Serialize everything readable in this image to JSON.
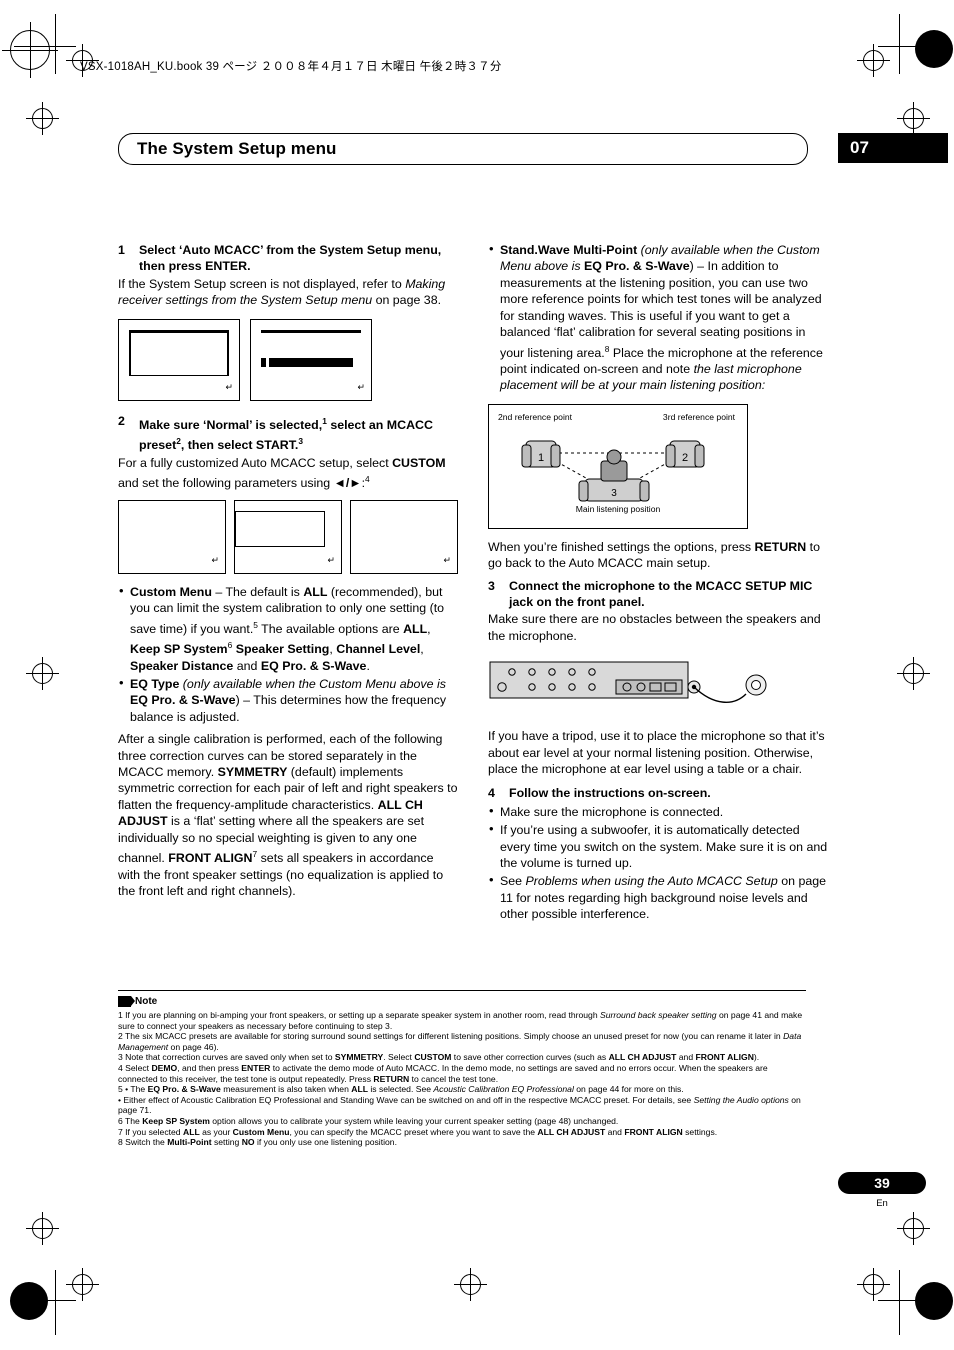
{
  "header": {
    "running_head": "VSX-1018AH_KU.book   39 ページ   ２００８年４月１７日   木曜日   午後２時３７分",
    "title": "The System Setup menu",
    "chapter": "07"
  },
  "left_column": {
    "step1": {
      "number": "1",
      "heading": "Select ‘Auto MCACC’ from the System Setup menu, then press ENTER.",
      "body_1": "If the System Setup screen is not displayed, refer to ",
      "body_italic": "Making receiver settings from the System Setup menu",
      "body_2": " on page 38."
    },
    "step2": {
      "number": "2",
      "heading_a": "Make sure ‘Normal’ is selected,",
      "heading_sup_a": "1",
      "heading_b": " select an MCACC preset",
      "heading_sup_b": "2",
      "heading_c": ", then select START.",
      "heading_sup_c": "3",
      "body_1": "For a fully customized Auto MCACC setup, select ",
      "body_bold": "CUSTOM",
      "body_2": " and set the following parameters using ",
      "body_arrows": "◄/►",
      "body_3": ":",
      "body_sup": "4"
    },
    "bullets": [
      {
        "parts": [
          {
            "t": "Custom Menu",
            "s": "b"
          },
          {
            "t": " – The default is ",
            "s": "n"
          },
          {
            "t": "ALL",
            "s": "b"
          },
          {
            "t": " (recommended), but you can limit the system calibration to only one setting (to save time) if you want.",
            "s": "n"
          },
          {
            "t": "5",
            "s": "sup"
          },
          {
            "t": " The available options are ",
            "s": "n"
          },
          {
            "t": "ALL",
            "s": "b"
          },
          {
            "t": ", ",
            "s": "n"
          },
          {
            "t": "Keep SP System",
            "s": "b"
          },
          {
            "t": "6",
            "s": "sup"
          },
          {
            "t": " ",
            "s": "n"
          },
          {
            "t": "Speaker Setting",
            "s": "b"
          },
          {
            "t": ", ",
            "s": "n"
          },
          {
            "t": "Channel Level",
            "s": "b"
          },
          {
            "t": ", ",
            "s": "n"
          },
          {
            "t": "Speaker Distance",
            "s": "b"
          },
          {
            "t": " and ",
            "s": "n"
          },
          {
            "t": "EQ Pro. & S-Wave",
            "s": "b"
          },
          {
            "t": ".",
            "s": "n"
          }
        ]
      },
      {
        "parts": [
          {
            "t": "EQ Type",
            "s": "b"
          },
          {
            "t": " (only available when the Custom Menu above is ",
            "s": "i"
          },
          {
            "t": "EQ Pro. & S-Wave",
            "s": "b"
          },
          {
            "t": ") – This determines how the frequency balance is adjusted.",
            "s": "n"
          }
        ]
      }
    ],
    "paragraph_parts": [
      {
        "t": "After a single calibration is performed, each of the following three correction curves can be stored separately in the MCACC memory. ",
        "s": "n"
      },
      {
        "t": "SYMMETRY",
        "s": "b"
      },
      {
        "t": " (default) implements symmetric correction for each pair of left and right speakers to flatten the frequency-amplitude characteristics. ",
        "s": "n"
      },
      {
        "t": "ALL CH ADJUST",
        "s": "b"
      },
      {
        "t": " is a ‘flat’ setting where all the speakers are set individually so no special weighting is given to any one channel. ",
        "s": "n"
      },
      {
        "t": "FRONT ALIGN",
        "s": "b"
      },
      {
        "t": "7",
        "s": "sup"
      },
      {
        "t": " sets all speakers in accordance with the front speaker settings (no equalization is applied to the front left and right channels).",
        "s": "n"
      }
    ]
  },
  "right_column": {
    "bullet_stand_wave": [
      {
        "t": "Stand.Wave Multi-Point",
        "s": "b"
      },
      {
        "t": " (only available when the Custom Menu above is ",
        "s": "i"
      },
      {
        "t": "EQ Pro. & S-Wave",
        "s": "b"
      },
      {
        "t": ") – In addition to measurements at the listening position, you can use two more reference points for which test tones will be analyzed for standing waves. This is useful if you want to get a balanced ‘flat’ calibration for several seating positions in your listening area.",
        "s": "n"
      },
      {
        "t": "8",
        "s": "sup"
      },
      {
        "t": " Place the microphone at the reference point indicated on-screen and note ",
        "s": "n"
      },
      {
        "t": "the last microphone placement will be at your main listening position:",
        "s": "i"
      }
    ],
    "diagram": {
      "label_2nd": "2nd reference\npoint",
      "label_3rd": "3rd reference\npoint",
      "label_main": "Main listening\nposition",
      "mark_1": "1",
      "mark_2": "2",
      "mark_3": "3"
    },
    "after_diagram": [
      {
        "t": "When you’re finished settings the options, press ",
        "s": "n"
      },
      {
        "t": "RETURN",
        "s": "b"
      },
      {
        "t": " to go back to the Auto MCACC main setup.",
        "s": "n"
      }
    ],
    "step3": {
      "number": "3",
      "heading": "Connect the microphone to the MCACC SETUP MIC jack on the front panel.",
      "body": "Make sure there are no obstacles between the speakers and the microphone."
    },
    "after_panel": "If you have a tripod, use it to place the microphone so that it’s about ear level at your normal listening position. Otherwise, place the microphone at ear level using a table or a chair.",
    "step4": {
      "number": "4",
      "heading": "Follow the instructions on-screen."
    },
    "step4_bullets": [
      [
        {
          "t": "Make sure the microphone is connected.",
          "s": "n"
        }
      ],
      [
        {
          "t": "If you’re using a subwoofer, it is automatically detected every time you switch on the system. Make sure it is on and the volume is turned up.",
          "s": "n"
        }
      ],
      [
        {
          "t": "See ",
          "s": "n"
        },
        {
          "t": "Problems when using the Auto MCACC Setup",
          "s": "i"
        },
        {
          "t": " on page 11 for notes regarding high background noise levels and other possible interference.",
          "s": "n"
        }
      ]
    ]
  },
  "notes": {
    "label": "Note",
    "items": [
      [
        {
          "t": "1 If you are planning on bi-amping your front speakers, or setting up a separate speaker system in another room, read through ",
          "s": "n"
        },
        {
          "t": "Surround back speaker setting",
          "s": "i"
        },
        {
          "t": " on page 41 and make sure to connect your speakers as necessary before continuing to step 3.",
          "s": "n"
        }
      ],
      [
        {
          "t": "2 The six MCACC presets are available for storing surround sound settings for different listening positions. Simply choose an unused preset for now (you can rename it later in ",
          "s": "n"
        },
        {
          "t": "Data Management",
          "s": "i"
        },
        {
          "t": " on page 46).",
          "s": "n"
        }
      ],
      [
        {
          "t": "3 Note that correction curves are saved only when set to ",
          "s": "n"
        },
        {
          "t": "SYMMETRY",
          "s": "b"
        },
        {
          "t": ". Select ",
          "s": "n"
        },
        {
          "t": "CUSTOM",
          "s": "b"
        },
        {
          "t": " to save other correction curves (such as ",
          "s": "n"
        },
        {
          "t": "ALL CH ADJUST",
          "s": "b"
        },
        {
          "t": " and ",
          "s": "n"
        },
        {
          "t": "FRONT ALIGN",
          "s": "b"
        },
        {
          "t": ").",
          "s": "n"
        }
      ],
      [
        {
          "t": "4 Select ",
          "s": "n"
        },
        {
          "t": "DEMO",
          "s": "b"
        },
        {
          "t": ", and then press ",
          "s": "n"
        },
        {
          "t": "ENTER",
          "s": "b"
        },
        {
          "t": " to activate the demo mode of Auto MCACC. In the demo mode, no settings are saved and no errors occur. When the speakers are connected to this receiver, the test tone is output repeatedly. Press ",
          "s": "n"
        },
        {
          "t": "RETURN",
          "s": "b"
        },
        {
          "t": " to cancel the test tone.",
          "s": "n"
        }
      ],
      [
        {
          "t": "5 • The ",
          "s": "n"
        },
        {
          "t": "EQ Pro. & S-Wave",
          "s": "b"
        },
        {
          "t": " measurement is also taken when ",
          "s": "n"
        },
        {
          "t": "ALL",
          "s": "b"
        },
        {
          "t": " is selected. See ",
          "s": "n"
        },
        {
          "t": "Acoustic Calibration EQ Professional",
          "s": "i"
        },
        {
          "t": " on page 44 for more on this.",
          "s": "n"
        }
      ],
      [
        {
          "t": "   • Either effect of Acoustic Calibration EQ Professional and Standing Wave can be switched on and off in the respective MCACC preset. For details, see ",
          "s": "n"
        },
        {
          "t": "Setting the Audio options",
          "s": "i"
        },
        {
          "t": " on page 71.",
          "s": "n"
        }
      ],
      [
        {
          "t": "6 The ",
          "s": "n"
        },
        {
          "t": "Keep SP System",
          "s": "b"
        },
        {
          "t": " option allows you to calibrate your system while leaving your current speaker setting (page 48) unchanged.",
          "s": "n"
        }
      ],
      [
        {
          "t": "7 If you selected ",
          "s": "n"
        },
        {
          "t": "ALL",
          "s": "b"
        },
        {
          "t": " as your ",
          "s": "n"
        },
        {
          "t": "Custom Menu",
          "s": "b"
        },
        {
          "t": ", you can specify the MCACC preset where you want to save the ",
          "s": "n"
        },
        {
          "t": "ALL CH ADJUST",
          "s": "b"
        },
        {
          "t": " and ",
          "s": "n"
        },
        {
          "t": "FRONT ALIGN",
          "s": "b"
        },
        {
          "t": " settings.",
          "s": "n"
        }
      ],
      [
        {
          "t": "8 Switch the ",
          "s": "n"
        },
        {
          "t": "Multi-Point",
          "s": "b"
        },
        {
          "t": " setting ",
          "s": "n"
        },
        {
          "t": "NO",
          "s": "b"
        },
        {
          "t": " if you only use one listening position.",
          "s": "n"
        }
      ]
    ]
  },
  "footer": {
    "page_number": "39",
    "lang": "En"
  }
}
